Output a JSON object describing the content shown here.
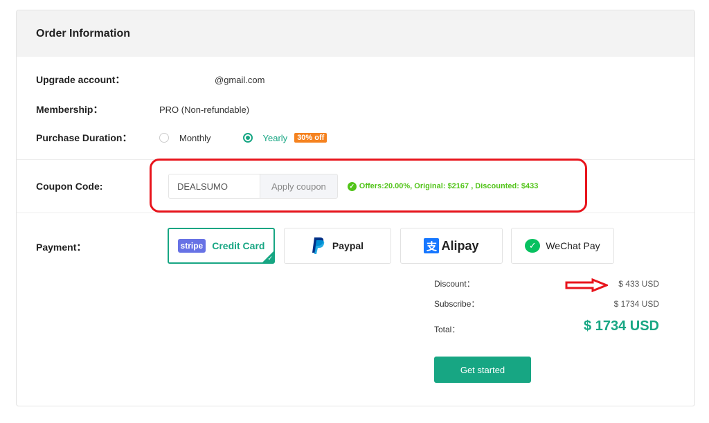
{
  "header": {
    "title": "Order Information"
  },
  "fields": {
    "upgrade_account": {
      "label": "Upgrade account：",
      "value": "@gmail.com"
    },
    "membership": {
      "label": "Membership：",
      "value": "PRO (Non-refundable)"
    },
    "purchase_duration": {
      "label": "Purchase Duration：",
      "options": [
        {
          "label": "Monthly",
          "checked": false
        },
        {
          "label": "Yearly",
          "checked": true,
          "badge": "30% off"
        }
      ]
    },
    "coupon": {
      "label": "Coupon Code:",
      "value": "DEALSUMO",
      "apply_label": "Apply coupon",
      "status": "Offers:20.00%, Original: $2167 , Discounted: $433"
    },
    "payment": {
      "label": "Payment：",
      "options": [
        {
          "logo": "stripe",
          "label": "Credit Card",
          "selected": true
        },
        {
          "logo": "paypal",
          "label": "Paypal",
          "selected": false
        },
        {
          "logo": "alipay",
          "label": "Alipay",
          "selected": false
        },
        {
          "logo": "wechat",
          "label": "WeChat Pay",
          "selected": false
        }
      ]
    }
  },
  "summary": {
    "discount": {
      "label": "Discount：",
      "value": "$ 433 USD"
    },
    "subscribe": {
      "label": "Subscribe：",
      "value": "$ 1734 USD"
    },
    "total": {
      "label": "Total：",
      "value": "$ 1734 USD"
    }
  },
  "cta": {
    "label": "Get started"
  },
  "colors": {
    "accent": "#17a683",
    "badge": "#f5821f",
    "success": "#52c41a",
    "annotation": "#e8141c"
  }
}
